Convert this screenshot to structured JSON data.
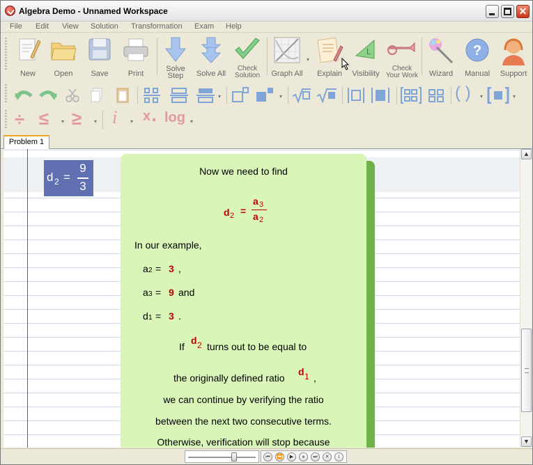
{
  "window": {
    "title": "Algebra Demo - Unnamed Workspace"
  },
  "menu": [
    "File",
    "Edit",
    "View",
    "Solution",
    "Transformation",
    "Exam",
    "Help"
  ],
  "toolbar": {
    "new": "New",
    "open": "Open",
    "save": "Save",
    "print": "Print",
    "solve_step_1": "Solve",
    "solve_step_2": "Step",
    "solve_all": "Solve All",
    "check_solution_1": "Check",
    "check_solution_2": "Solution",
    "graph_all": "Graph All",
    "explain": "Explain",
    "visibility": "Visibility",
    "check_work_1": "Check",
    "check_work_2": "Your Work",
    "wizard": "Wizard",
    "manual": "Manual",
    "support": "Support"
  },
  "format_bar": {
    "log_label": "log",
    "var_i": "i",
    "var_x": "x"
  },
  "tabs": [
    {
      "label": "Problem 1"
    }
  ],
  "equation": {
    "var": "d",
    "sub": "2",
    "equals": "=",
    "num": "9",
    "den": "3"
  },
  "explanation": {
    "line1": "Now we need to find",
    "formula": {
      "lhs": "d",
      "lhs_sub": "2",
      "eq": "=",
      "num": "a",
      "num_sub": "3",
      "den": "a",
      "den_sub": "2"
    },
    "in_example": "In our example,",
    "a2_label": "a",
    "a2_sub": "2",
    "a2_eq": "=",
    "a2_value": "3",
    "a2_tail": ",",
    "a3_label": "a",
    "a3_sub": "3",
    "a3_eq": "=",
    "a3_value": "9",
    "a3_tail": "and",
    "d1_label": "d",
    "d1_sub": "1",
    "d1_eq": "=",
    "d1_value": "3",
    "d1_tail": ".",
    "if_pre": "If",
    "if_var": "d",
    "if_sub": "2",
    "if_post": "turns out to be equal to",
    "ratio_pre": "the originally defined ratio",
    "ratio_var": "d",
    "ratio_sub": "1",
    "ratio_post": ",",
    "line_continue": "we can continue by verifying the ratio",
    "line_between": "between the next two consecutive terms.",
    "line_otherwise": "Otherwise, verification will stop because"
  },
  "colors": {
    "accent_red": "#c00000",
    "equation_box": "#5f6fb0",
    "explain_bg": "#d9f5b8",
    "explain_shadow": "#6fb24a"
  }
}
